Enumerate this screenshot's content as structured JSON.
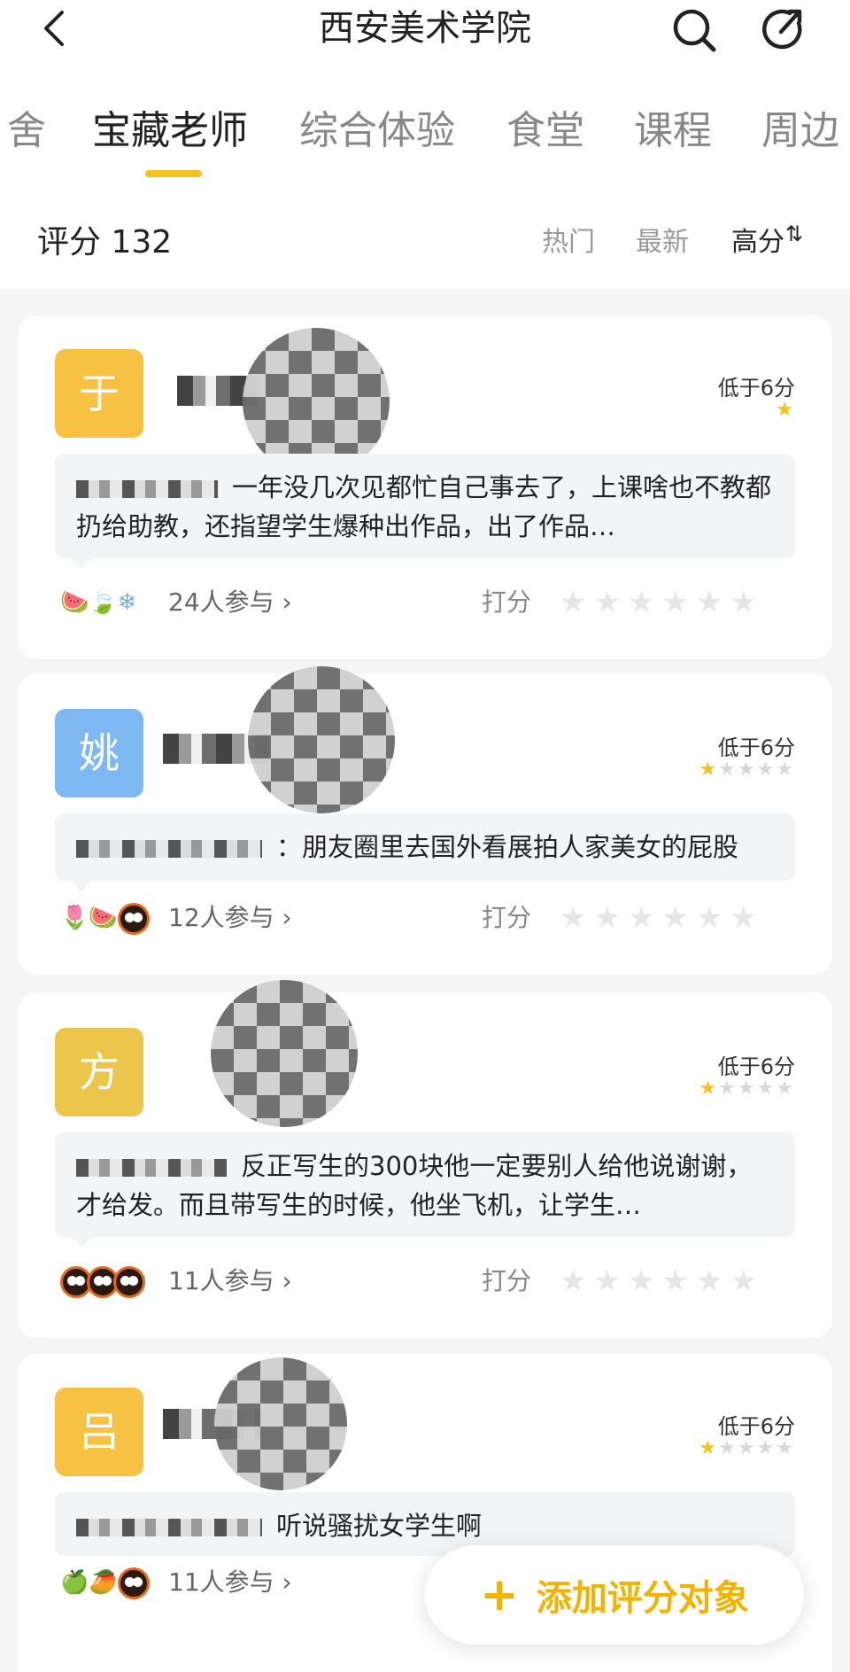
{
  "header": {
    "title": "西安美术学院"
  },
  "tabs": [
    {
      "label": "舍",
      "active": false
    },
    {
      "label": "宝藏老师",
      "active": true
    },
    {
      "label": "综合体验",
      "active": false
    },
    {
      "label": "食堂",
      "active": false
    },
    {
      "label": "课程",
      "active": false
    },
    {
      "label": "周边",
      "active": false
    }
  ],
  "filter": {
    "score_label": "评分 132",
    "sort_options": [
      "热门",
      "最新",
      "高分"
    ],
    "active_sort": "高分"
  },
  "cards": [
    {
      "avatar_char": "于",
      "avatar_color": "#f7c244",
      "score_text": "低于6分",
      "stars": 0.5,
      "comment": "一年没几次见都忙自己事去了，上课啥也不教都扔给助教，还指望学生爆种出作品，出了作品…",
      "emojis": [
        "🍉",
        "🍃",
        "❄"
      ],
      "participants": "24人参与 ›",
      "rate_label": "打分"
    },
    {
      "avatar_char": "姚",
      "avatar_color": "#7eb8f2",
      "score_text": "低于6分",
      "stars": 1,
      "comment": "：朋友圈里去国外看展拍人家美女的屁股",
      "emojis": [
        "🌷",
        "🍉"
      ],
      "participants": "12人参与 ›",
      "rate_label": "打分"
    },
    {
      "avatar_char": "方",
      "avatar_color": "#ecc64a",
      "score_text": "低于6分",
      "stars": 0.5,
      "comment": "反正写生的300块他一定要别人给他说谢谢，才给发。而且带写生的时候，他坐飞机，让学生…",
      "emojis": [],
      "participants": "11人参与 ›",
      "rate_label": "打分"
    },
    {
      "avatar_char": "吕",
      "avatar_color": "#f7c244",
      "score_text": "低于6分",
      "stars": 0.5,
      "comment": "听说骚扰女学生啊",
      "emojis": [
        "🍏",
        "🥭"
      ],
      "participants": "11人参与 ›",
      "rate_label": "打分"
    }
  ],
  "add_button": {
    "label": "添加评分对象",
    "icon": "plus-icon"
  }
}
